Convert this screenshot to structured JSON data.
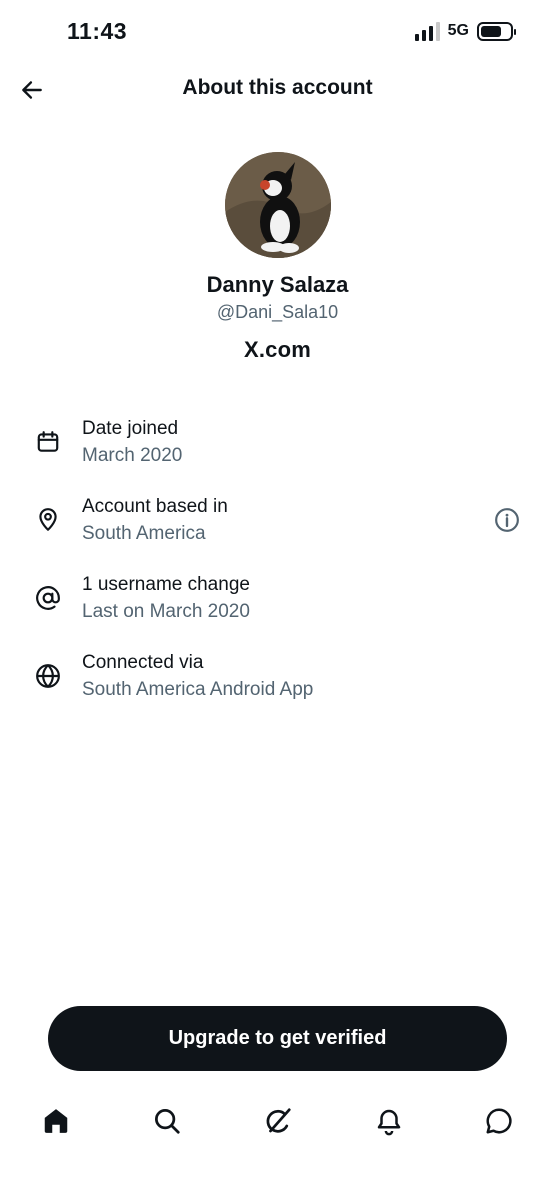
{
  "status_bar": {
    "time": "11:43",
    "network": "5G",
    "signal_bars_filled": 3,
    "signal_bars_total": 4
  },
  "header": {
    "title": "About this account",
    "back_icon": "arrow-left-icon"
  },
  "profile": {
    "display_name": "Danny Salaza",
    "handle": "@Dani_Sala10",
    "site_label": "X.com"
  },
  "info": [
    {
      "icon": "calendar-icon",
      "title": "Date joined",
      "subtitle": "March 2020"
    },
    {
      "icon": "location-pin-icon",
      "title": "Account based in",
      "subtitle": "South America",
      "extra_icon": "info-circle-icon"
    },
    {
      "icon": "at-sign-icon",
      "title": "1 username change",
      "subtitle": "Last on March 2020"
    },
    {
      "icon": "globe-icon",
      "title": "Connected via",
      "subtitle": "South America Android App"
    }
  ],
  "upgrade_button": {
    "label": "Upgrade to get verified"
  },
  "tab_bar": {
    "items": [
      {
        "name": "home",
        "icon": "home-icon"
      },
      {
        "name": "search",
        "icon": "search-icon"
      },
      {
        "name": "grok",
        "icon": "grok-icon"
      },
      {
        "name": "notifications",
        "icon": "bell-icon"
      },
      {
        "name": "messages",
        "icon": "chat-bubble-icon"
      }
    ]
  },
  "colors": {
    "primary_text": "#0f1419",
    "secondary_text": "#536471",
    "button_bg": "#0f1419",
    "background": "#ffffff"
  }
}
